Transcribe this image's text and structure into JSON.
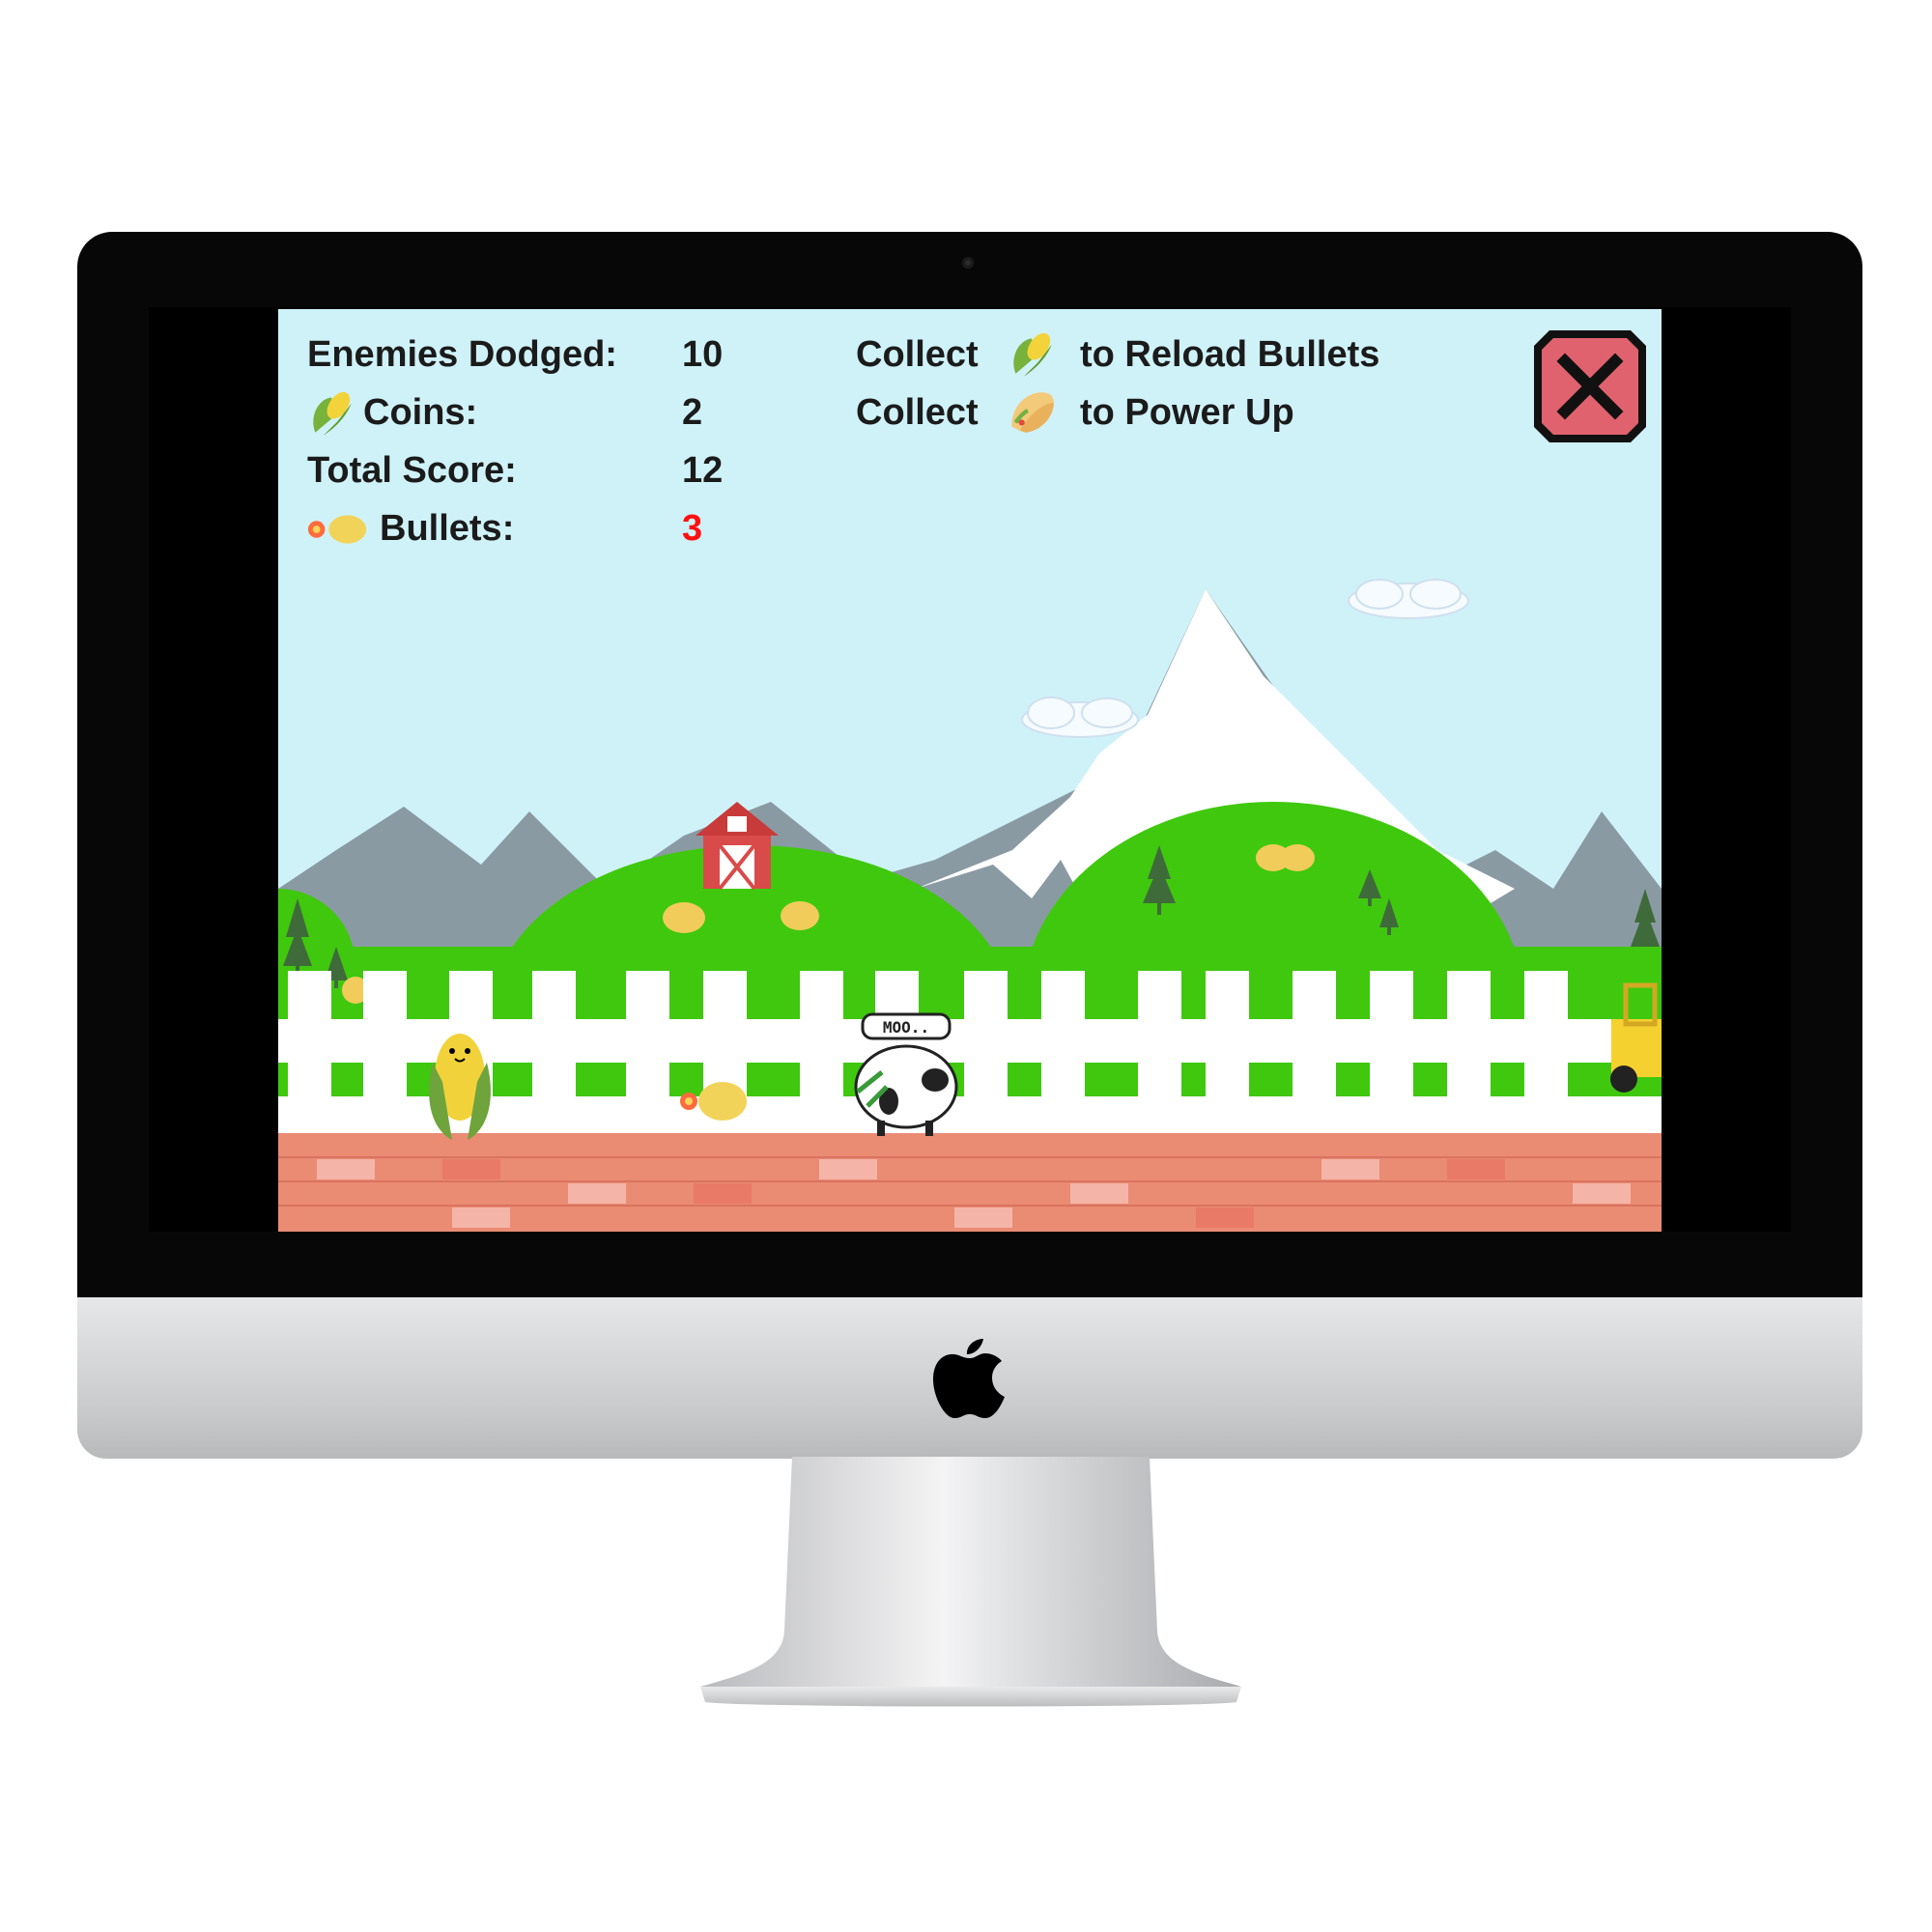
{
  "hud": {
    "enemies_dodged_label": "Enemies Dodged:",
    "enemies_dodged_value": "10",
    "coins_label": "Coins:",
    "coins_value": "2",
    "total_score_label": "Total Score:",
    "total_score_value": "12",
    "bullets_label": "Bullets:",
    "bullets_value": "3"
  },
  "hints": {
    "reload_prefix": "Collect",
    "reload_suffix": "to Reload Bullets",
    "powerup_prefix": "Collect",
    "powerup_suffix": "to Power Up"
  },
  "speech_bubble": "MOO..",
  "icons": {
    "coin": "corn-coin-icon",
    "bullet": "corn-bullet-icon",
    "powerup": "taco-icon",
    "close": "close-icon"
  },
  "colors": {
    "sky": "#cff2f9",
    "mountain": "#8a9aa3",
    "snow": "#ffffff",
    "hill": "#3fc80e",
    "fence": "#ffffff",
    "brick": "#ea8b74",
    "bullets_value": "#ff1111",
    "close_button": "#e0626e"
  }
}
